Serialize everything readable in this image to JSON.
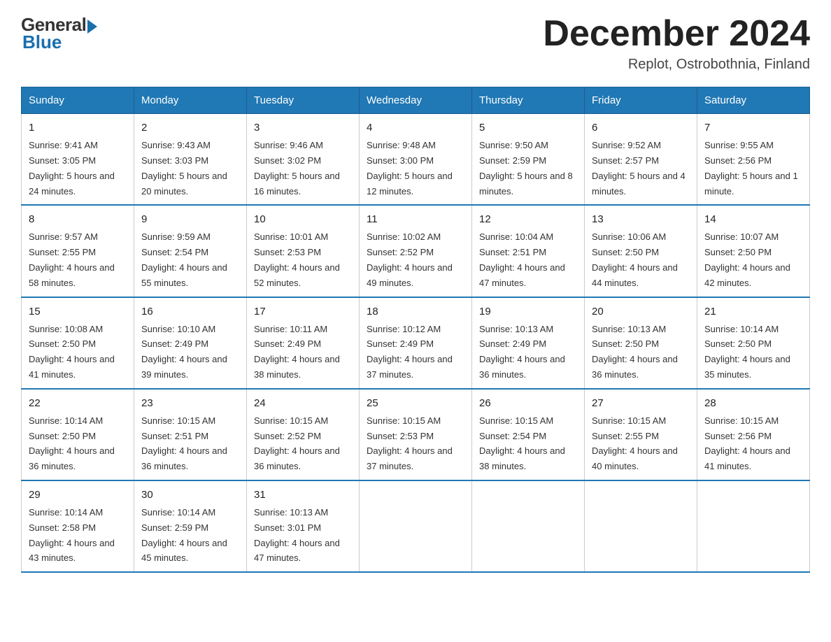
{
  "logo": {
    "general": "General",
    "blue": "Blue"
  },
  "title": "December 2024",
  "location": "Replot, Ostrobothnia, Finland",
  "days_of_week": [
    "Sunday",
    "Monday",
    "Tuesday",
    "Wednesday",
    "Thursday",
    "Friday",
    "Saturday"
  ],
  "weeks": [
    [
      {
        "day": "1",
        "sunrise": "9:41 AM",
        "sunset": "3:05 PM",
        "daylight": "5 hours and 24 minutes."
      },
      {
        "day": "2",
        "sunrise": "9:43 AM",
        "sunset": "3:03 PM",
        "daylight": "5 hours and 20 minutes."
      },
      {
        "day": "3",
        "sunrise": "9:46 AM",
        "sunset": "3:02 PM",
        "daylight": "5 hours and 16 minutes."
      },
      {
        "day": "4",
        "sunrise": "9:48 AM",
        "sunset": "3:00 PM",
        "daylight": "5 hours and 12 minutes."
      },
      {
        "day": "5",
        "sunrise": "9:50 AM",
        "sunset": "2:59 PM",
        "daylight": "5 hours and 8 minutes."
      },
      {
        "day": "6",
        "sunrise": "9:52 AM",
        "sunset": "2:57 PM",
        "daylight": "5 hours and 4 minutes."
      },
      {
        "day": "7",
        "sunrise": "9:55 AM",
        "sunset": "2:56 PM",
        "daylight": "5 hours and 1 minute."
      }
    ],
    [
      {
        "day": "8",
        "sunrise": "9:57 AM",
        "sunset": "2:55 PM",
        "daylight": "4 hours and 58 minutes."
      },
      {
        "day": "9",
        "sunrise": "9:59 AM",
        "sunset": "2:54 PM",
        "daylight": "4 hours and 55 minutes."
      },
      {
        "day": "10",
        "sunrise": "10:01 AM",
        "sunset": "2:53 PM",
        "daylight": "4 hours and 52 minutes."
      },
      {
        "day": "11",
        "sunrise": "10:02 AM",
        "sunset": "2:52 PM",
        "daylight": "4 hours and 49 minutes."
      },
      {
        "day": "12",
        "sunrise": "10:04 AM",
        "sunset": "2:51 PM",
        "daylight": "4 hours and 47 minutes."
      },
      {
        "day": "13",
        "sunrise": "10:06 AM",
        "sunset": "2:50 PM",
        "daylight": "4 hours and 44 minutes."
      },
      {
        "day": "14",
        "sunrise": "10:07 AM",
        "sunset": "2:50 PM",
        "daylight": "4 hours and 42 minutes."
      }
    ],
    [
      {
        "day": "15",
        "sunrise": "10:08 AM",
        "sunset": "2:50 PM",
        "daylight": "4 hours and 41 minutes."
      },
      {
        "day": "16",
        "sunrise": "10:10 AM",
        "sunset": "2:49 PM",
        "daylight": "4 hours and 39 minutes."
      },
      {
        "day": "17",
        "sunrise": "10:11 AM",
        "sunset": "2:49 PM",
        "daylight": "4 hours and 38 minutes."
      },
      {
        "day": "18",
        "sunrise": "10:12 AM",
        "sunset": "2:49 PM",
        "daylight": "4 hours and 37 minutes."
      },
      {
        "day": "19",
        "sunrise": "10:13 AM",
        "sunset": "2:49 PM",
        "daylight": "4 hours and 36 minutes."
      },
      {
        "day": "20",
        "sunrise": "10:13 AM",
        "sunset": "2:50 PM",
        "daylight": "4 hours and 36 minutes."
      },
      {
        "day": "21",
        "sunrise": "10:14 AM",
        "sunset": "2:50 PM",
        "daylight": "4 hours and 35 minutes."
      }
    ],
    [
      {
        "day": "22",
        "sunrise": "10:14 AM",
        "sunset": "2:50 PM",
        "daylight": "4 hours and 36 minutes."
      },
      {
        "day": "23",
        "sunrise": "10:15 AM",
        "sunset": "2:51 PM",
        "daylight": "4 hours and 36 minutes."
      },
      {
        "day": "24",
        "sunrise": "10:15 AM",
        "sunset": "2:52 PM",
        "daylight": "4 hours and 36 minutes."
      },
      {
        "day": "25",
        "sunrise": "10:15 AM",
        "sunset": "2:53 PM",
        "daylight": "4 hours and 37 minutes."
      },
      {
        "day": "26",
        "sunrise": "10:15 AM",
        "sunset": "2:54 PM",
        "daylight": "4 hours and 38 minutes."
      },
      {
        "day": "27",
        "sunrise": "10:15 AM",
        "sunset": "2:55 PM",
        "daylight": "4 hours and 40 minutes."
      },
      {
        "day": "28",
        "sunrise": "10:15 AM",
        "sunset": "2:56 PM",
        "daylight": "4 hours and 41 minutes."
      }
    ],
    [
      {
        "day": "29",
        "sunrise": "10:14 AM",
        "sunset": "2:58 PM",
        "daylight": "4 hours and 43 minutes."
      },
      {
        "day": "30",
        "sunrise": "10:14 AM",
        "sunset": "2:59 PM",
        "daylight": "4 hours and 45 minutes."
      },
      {
        "day": "31",
        "sunrise": "10:13 AM",
        "sunset": "3:01 PM",
        "daylight": "4 hours and 47 minutes."
      },
      null,
      null,
      null,
      null
    ]
  ],
  "labels": {
    "sunrise": "Sunrise:",
    "sunset": "Sunset:",
    "daylight": "Daylight:"
  }
}
